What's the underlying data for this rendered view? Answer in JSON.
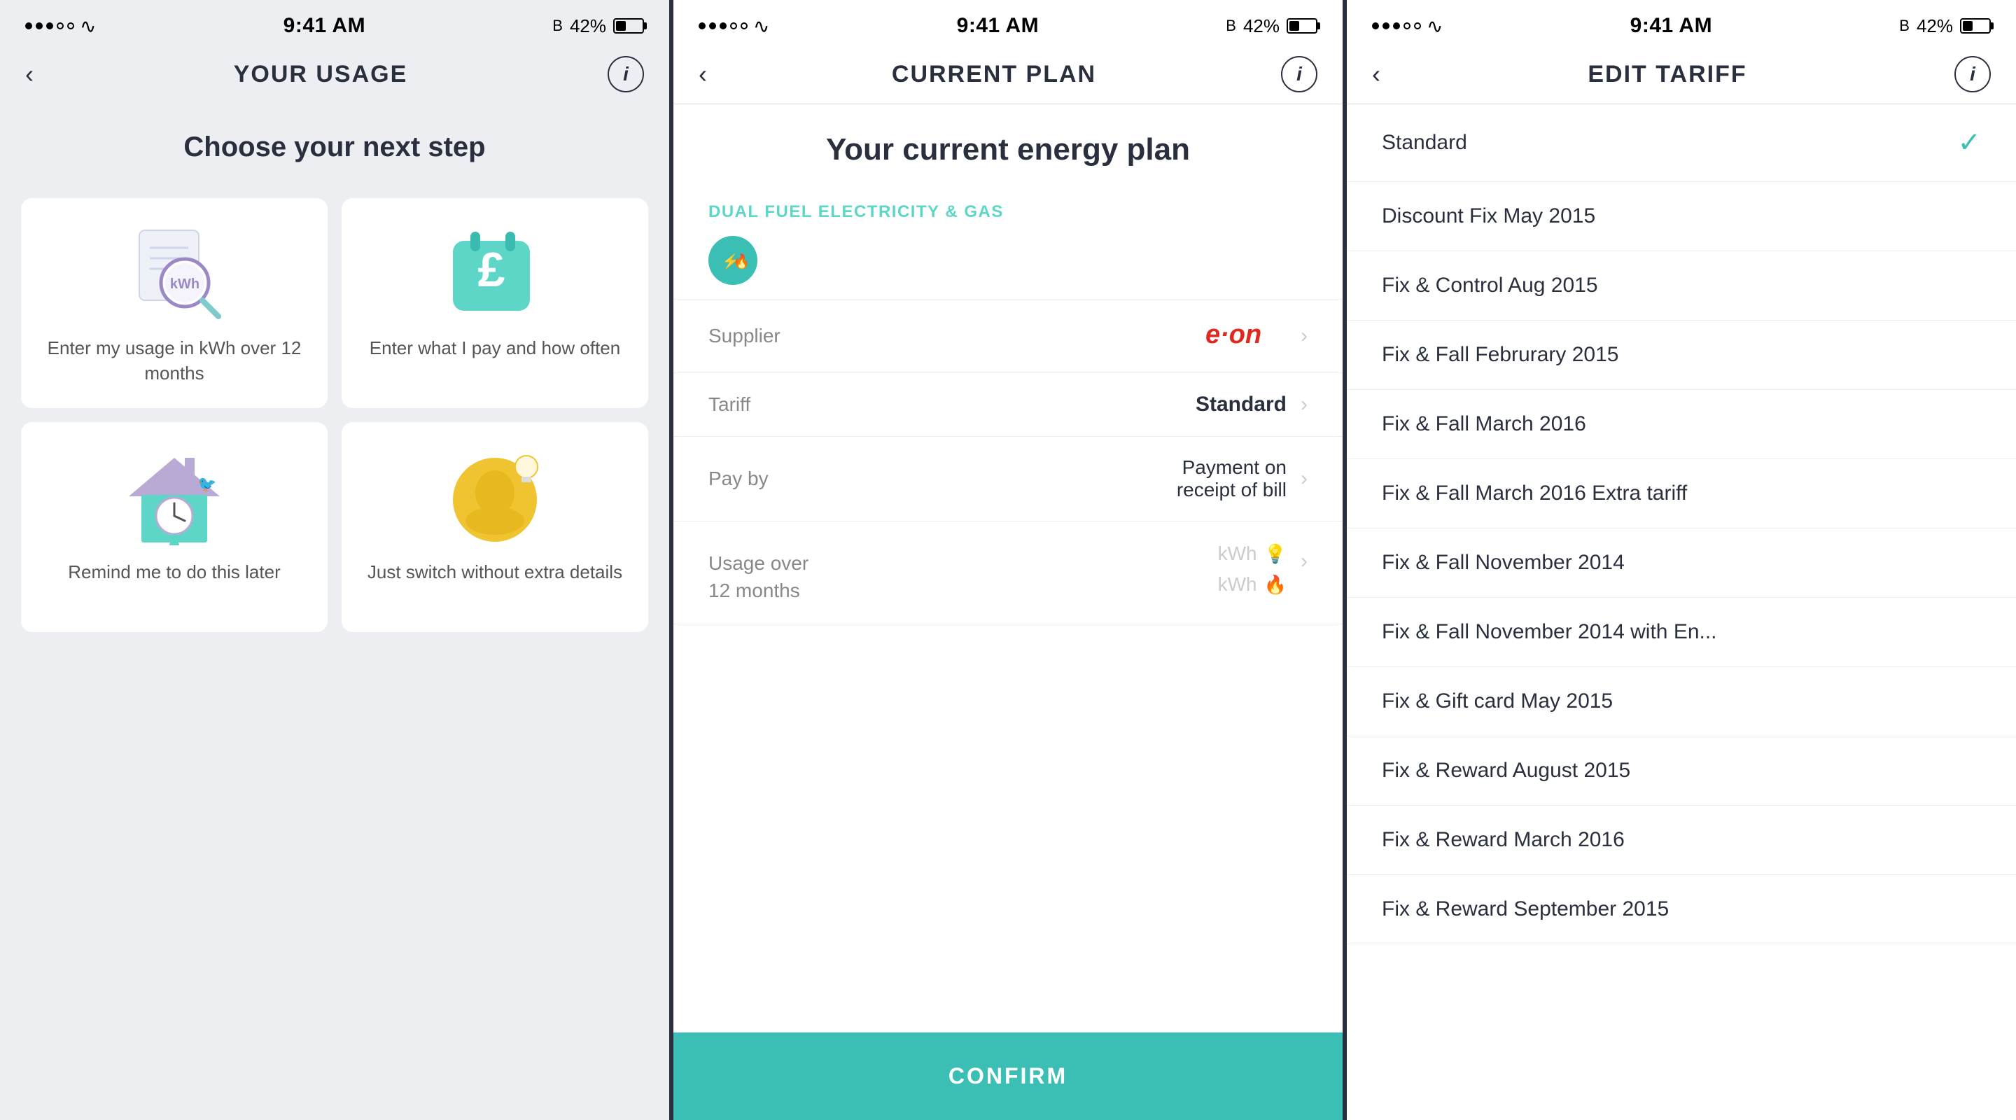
{
  "statusBar": {
    "time": "9:41 AM",
    "battery": "42%",
    "bluetooth": "BT"
  },
  "panel1": {
    "title": "YOUR USAGE",
    "heading": "Choose your next step",
    "cards": [
      {
        "id": "kwh-usage",
        "label": "Enter my usage in kWh over 12 months"
      },
      {
        "id": "pay-amount",
        "label": "Enter what I pay and how often"
      },
      {
        "id": "remind-later",
        "label": "Remind me to do this later"
      },
      {
        "id": "just-switch",
        "label": "Just switch without extra details"
      }
    ]
  },
  "panel2": {
    "title": "CURRENT PLAN",
    "heading": "Your current energy plan",
    "fuelLabel": "DUAL FUEL ELECTRICITY & GAS",
    "rows": [
      {
        "label": "Supplier",
        "value": "e·on",
        "style": "bold"
      },
      {
        "label": "Tariff",
        "value": "Standard",
        "style": "bold"
      },
      {
        "label": "Pay by",
        "value": "Payment on receipt of bill",
        "style": "normal"
      },
      {
        "label": "Usage over 12 months",
        "value": "kWh",
        "style": "muted"
      }
    ],
    "confirmLabel": "CONFIRM"
  },
  "panel3": {
    "title": "EDIT TARIFF",
    "tariffs": [
      {
        "label": "Standard",
        "selected": true
      },
      {
        "label": "Discount Fix May 2015",
        "selected": false
      },
      {
        "label": "Fix & Control Aug 2015",
        "selected": false
      },
      {
        "label": "Fix & Fall Februrary 2015",
        "selected": false
      },
      {
        "label": "Fix & Fall March 2016",
        "selected": false
      },
      {
        "label": "Fix & Fall March 2016 Extra tariff",
        "selected": false
      },
      {
        "label": "Fix & Fall November 2014",
        "selected": false
      },
      {
        "label": "Fix & Fall November 2014 with En...",
        "selected": false
      },
      {
        "label": "Fix & Gift card May 2015",
        "selected": false
      },
      {
        "label": "Fix & Reward August 2015",
        "selected": false
      },
      {
        "label": "Fix & Reward March 2016",
        "selected": false
      },
      {
        "label": "Fix & Reward September 2015",
        "selected": false
      }
    ]
  }
}
